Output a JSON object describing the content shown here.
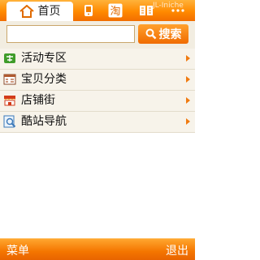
{
  "tabs": {
    "home_label": "首页",
    "tab2_label": "淘",
    "watermark": "JL-Iniche"
  },
  "search": {
    "value": "",
    "placeholder": "",
    "button_label": "搜索"
  },
  "menu": {
    "items": [
      {
        "label": "活动专区",
        "icon": "sale-icon"
      },
      {
        "label": "宝贝分类",
        "icon": "category-icon"
      },
      {
        "label": "店铺街",
        "icon": "shop-icon"
      },
      {
        "label": "酷站导航",
        "icon": "navigation-icon"
      }
    ]
  },
  "softkeys": {
    "left": "菜单",
    "right": "退出"
  },
  "colors": {
    "accent": "#ff8a00",
    "accent_dark": "#f06b00",
    "list_bg": "#f7f3ea"
  }
}
